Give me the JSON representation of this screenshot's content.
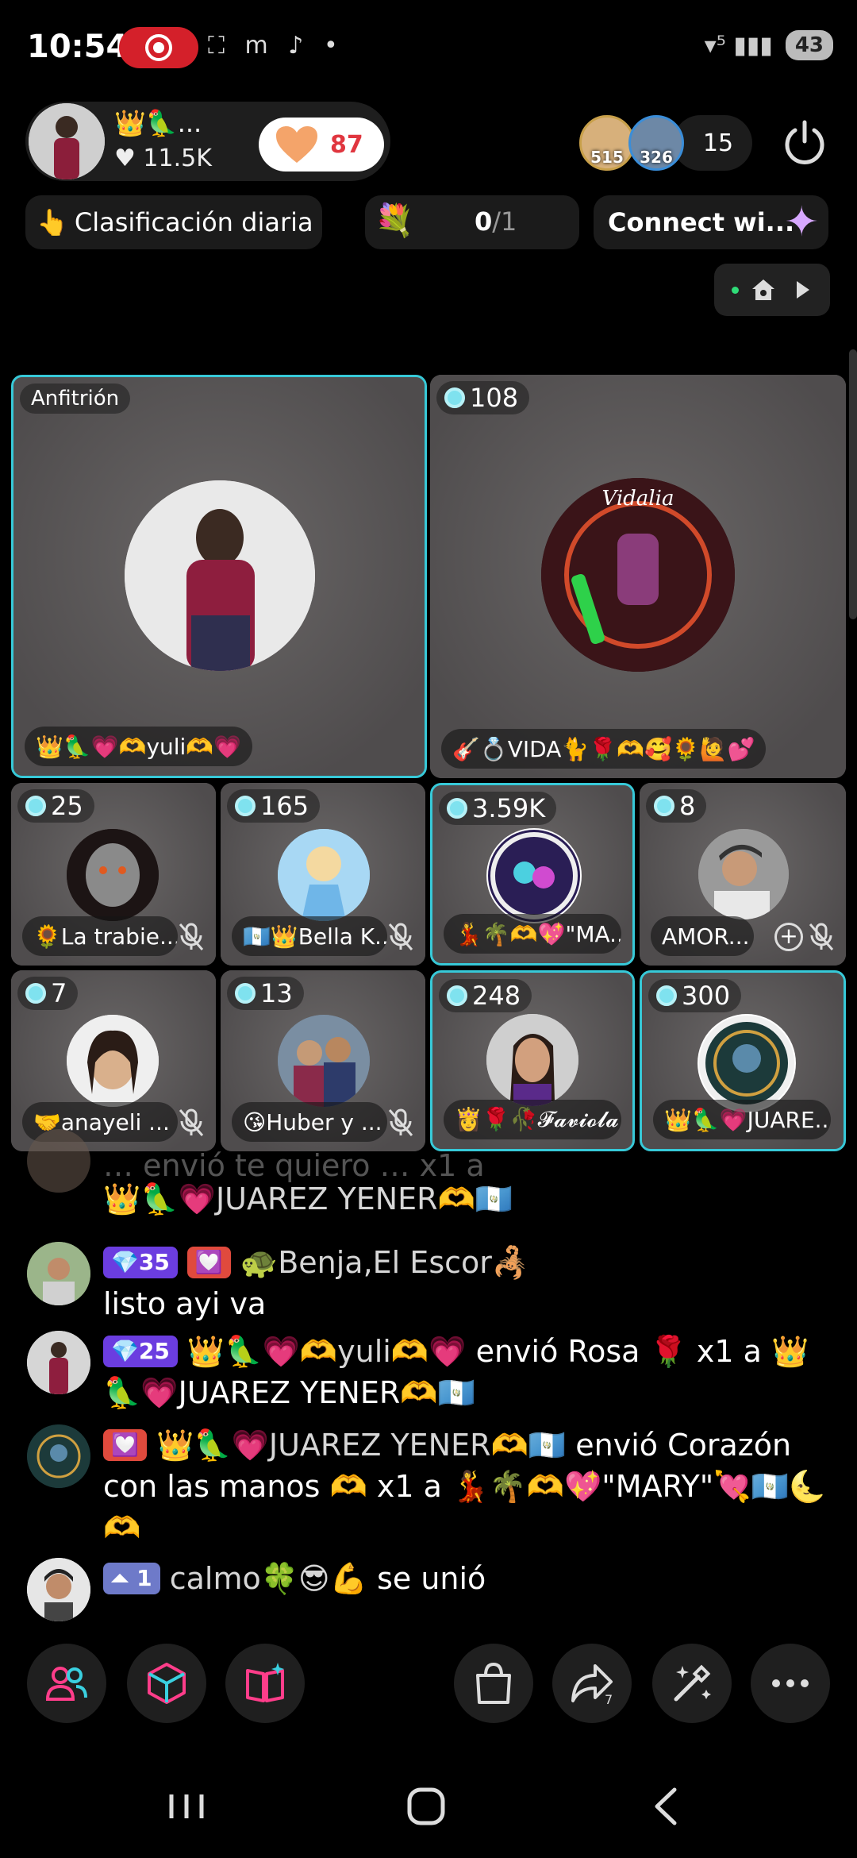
{
  "status_bar": {
    "time": "10:54",
    "icons_text": "⛶ m ♪ •",
    "signal": "▾⁵ ▮▮▮",
    "battery": "43"
  },
  "host": {
    "badges": "👑🦜...",
    "likes_count": "♥ 11.5K"
  },
  "likes_pill": {
    "count": "87"
  },
  "viewers": {
    "v1_score": "515",
    "v2_score": "326",
    "count": "15"
  },
  "daily_rank": {
    "label": "Clasificación diaria",
    "icon": "👆"
  },
  "goal": {
    "gift_icon": "💐",
    "current": "0",
    "total": "/1"
  },
  "connect": {
    "label": "Connect wi...",
    "spark": "✦"
  },
  "tiles": [
    {
      "tag": "Anfitrión",
      "name": "👑🦜💗🫶yuli🫶💗"
    },
    {
      "score": "108",
      "name": "🎸💍VIDA🐈🌹🫶🥰🌻🙋💕",
      "art_text": "Vidalia"
    },
    {
      "score": "25",
      "name": "🌻La trabie..."
    },
    {
      "score": "165",
      "name": "🇬🇹👑Bella K..."
    },
    {
      "score": "3.59K",
      "name": "💃🌴🫶💖\"MA..."
    },
    {
      "score": "8",
      "name": "AMOR...",
      "plus": "+"
    },
    {
      "score": "7",
      "name": "🤝anayeli ..."
    },
    {
      "score": "13",
      "name": "😘Huber y ..."
    },
    {
      "score": "248",
      "name": "👸🌹🥀𝓕𝓪𝓿𝓲𝓸𝓵𝓪..."
    },
    {
      "score": "300",
      "name": "👑🦜💗JUARE..."
    }
  ],
  "chat": [
    {
      "top_partial": "… envió te quiero … x1 a",
      "line2": "👑🦜💗JUAREZ YENER🫶🇬🇹"
    },
    {
      "badge_dia": "💎35",
      "badge_fan": "💟",
      "user": "🐢Benja,El Escor🦂",
      "text": "listo ayi va"
    },
    {
      "badge_dia": "💎25",
      "user": "👑🦜💗🫶yuli🫶💗",
      "text": "envió Rosa 🌹 x1 a 👑🦜💗JUAREZ YENER🫶🇬🇹"
    },
    {
      "badge_fan": "💟",
      "user": "👑🦜💗JUAREZ YENER🫶🇬🇹",
      "text": "envió Corazón con las manos 🫶 x1 a 💃🌴🫶💖\"MARY\"💘🇬🇹🌜🫶"
    },
    {
      "badge_lvl": "⏶ 1",
      "user": "calmo🍀😎💪",
      "text": "se unió"
    }
  ],
  "colors": {
    "accent_cyan": "#37c9d8",
    "like_red": "#e0363f",
    "diamond_purple": "#6b3de0"
  }
}
